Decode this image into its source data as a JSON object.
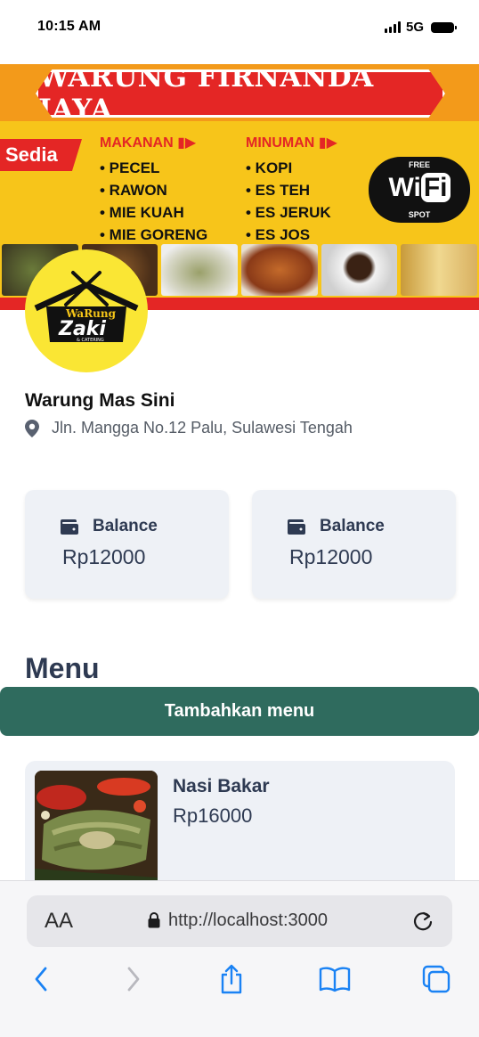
{
  "status_bar": {
    "time": "10:15 AM",
    "network": "5G"
  },
  "banner": {
    "title": "WARUNG FIRNANDA JAYA",
    "tag": "Sedia",
    "food_heading": "MAKANAN",
    "food_items": [
      "• PECEL",
      "• RAWON",
      "• MIE KUAH",
      "• MIE GORENG"
    ],
    "drink_heading": "MINUMAN",
    "drink_items": [
      "• KOPI",
      "• ES TEH",
      "• ES JERUK",
      "• ES JOS"
    ],
    "wifi_top": "FREE",
    "wifi_main_a": "Wi",
    "wifi_main_b": "Fi",
    "wifi_bottom": "SPOT"
  },
  "logo": {
    "line1": "WaRung",
    "line2": "Zaki",
    "line3": "& CATERING"
  },
  "place": {
    "name": "Warung Mas Sini",
    "address": "Jln. Mangga No.12 Palu, Sulawesi Tengah",
    "icon": "map-pin-icon"
  },
  "balances": [
    {
      "label": "Balance",
      "value": "Rp12000",
      "icon": "wallet-icon"
    },
    {
      "label": "Balance",
      "value": "Rp12000",
      "icon": "wallet-icon"
    }
  ],
  "menu": {
    "heading": "Menu",
    "add_button": "Tambahkan menu",
    "items": [
      {
        "name": "Nasi Bakar",
        "price": "Rp16000"
      }
    ]
  },
  "browser": {
    "aa_label": "AA",
    "url": "http://localhost:3000"
  },
  "colors": {
    "accent_green": "#2f6b5e",
    "card_bg": "#eef1f6",
    "text_dark": "#2e3a52",
    "banner_yellow": "#f7c51a",
    "banner_red": "#e42625",
    "logo_yellow": "#fae634",
    "ios_blue": "#1a82f4"
  }
}
